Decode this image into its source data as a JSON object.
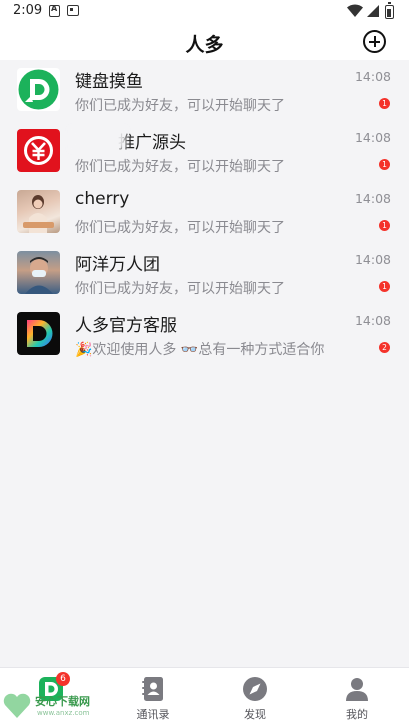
{
  "status_bar": {
    "time": "2:09"
  },
  "header": {
    "title": "人多"
  },
  "chats": [
    {
      "name": "键盘摸鱼",
      "preview": "你们已成为好友，可以开始聊天了",
      "time": "14:08",
      "unread": "1"
    },
    {
      "name": "推广源头",
      "preview": "你们已成为好友，可以开始聊天了",
      "time": "14:08",
      "unread": "1"
    },
    {
      "name": "cherry",
      "preview": "你们已成为好友，可以开始聊天了",
      "time": "14:08",
      "unread": "1"
    },
    {
      "name": "阿洋万人团",
      "preview": "你们已成为好友，可以开始聊天了",
      "time": "14:08",
      "unread": "1"
    },
    {
      "name": "人多官方客服",
      "preview": "🎉欢迎使用人多 👓总有一种方式适合你",
      "time": "14:08",
      "unread": "2"
    }
  ],
  "tabs": [
    {
      "label": "",
      "badge": "6",
      "icon": "chat-logo-icon"
    },
    {
      "label": "通讯录",
      "icon": "contacts-icon"
    },
    {
      "label": "发现",
      "icon": "compass-icon"
    },
    {
      "label": "我的",
      "icon": "person-icon"
    }
  ],
  "watermark": {
    "text": "安心下载网",
    "sub": "www.anxz.com"
  },
  "colors": {
    "accent_green": "#1cb25b",
    "badge_red": "#f4332b",
    "rmb_red": "#e1121d"
  }
}
